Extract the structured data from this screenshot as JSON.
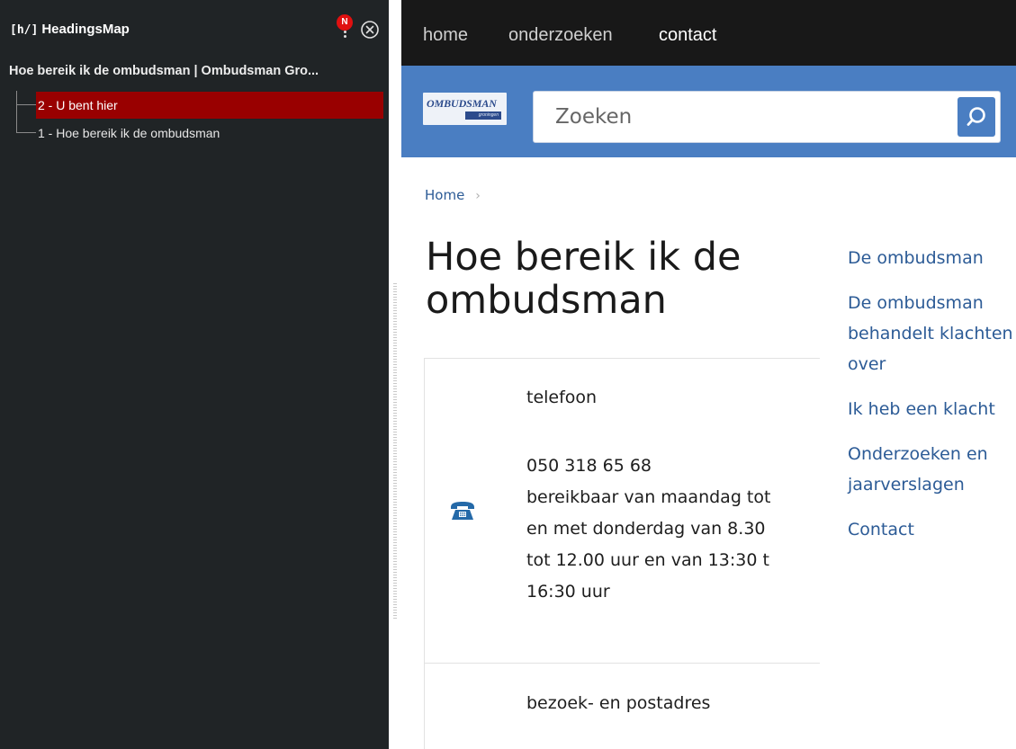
{
  "headingsmap": {
    "title": "HeadingsMap",
    "logo_glyph": "[h/]",
    "notification_badge": "N",
    "page_title": "Hoe bereik ik de ombudsman | Ombudsman Gro...",
    "headings": [
      {
        "label": "2 - U bent hier",
        "active": true
      },
      {
        "label": "1 - Hoe bereik ik de ombudsman",
        "active": false
      }
    ],
    "active_color": "#990000"
  },
  "site": {
    "nav": [
      "home",
      "onderzoeken",
      "contact"
    ],
    "brand_color": "#4a7ec2",
    "logo": {
      "main": "OMBUDSMAN",
      "sub": "groningen"
    },
    "search": {
      "placeholder": "Zoeken"
    },
    "breadcrumb": {
      "home": "Home",
      "separator": "›"
    },
    "heading_line1": "Hoe bereik ik de",
    "heading_line2": "ombudsman",
    "card": {
      "phone_label": "telefoon",
      "phone_lines": [
        "050 318 65 68",
        "bereikbaar van maandag tot",
        "en met donderdag van 8.30",
        "tot 12.00 uur en van 13:30 t",
        "16:30 uur"
      ],
      "address_label": "bezoek- en postadres"
    },
    "sidenav": [
      "De ombudsman",
      "De ombudsman behandelt klachten over",
      "Ik heb een klacht",
      "Onderzoeken en jaarverslagen",
      "Contact"
    ]
  }
}
